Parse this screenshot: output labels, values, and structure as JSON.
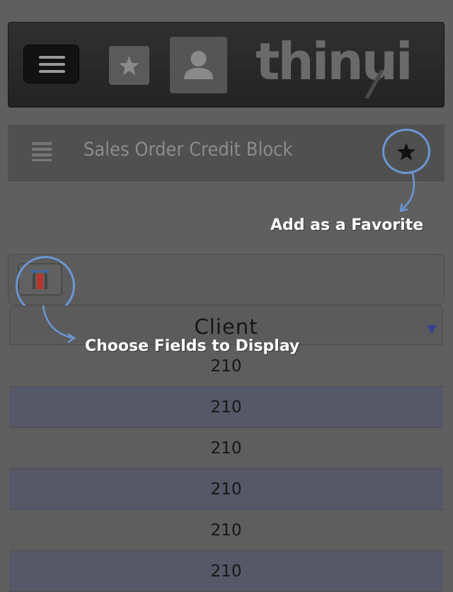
{
  "app": {
    "logo_text": "thinui",
    "menu_icon": "hamburger-icon",
    "favorites_icon": "star-icon",
    "user_icon": "user-icon"
  },
  "page": {
    "title": "Sales Order Credit Block",
    "list_icon": "list-icon",
    "favorite_icon": "star-icon"
  },
  "toolbar": {
    "columns_icon": "column-chooser-icon"
  },
  "table": {
    "column_header": "Client",
    "sort_icon": "sort-down-icon",
    "rows": [
      "210",
      "210",
      "210",
      "210",
      "210",
      "210"
    ]
  },
  "annotations": {
    "favorite": "Add as a Favorite",
    "fields": "Choose Fields to Display"
  },
  "colors": {
    "annotation_ring": "#6b97d4",
    "annotation_text": "#ffffff",
    "row_alt": "#565868",
    "sort_arrow": "#3b3f8f"
  }
}
